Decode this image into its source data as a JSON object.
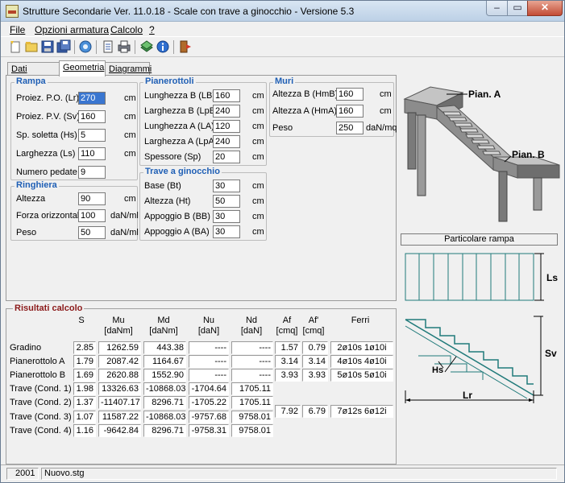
{
  "window": {
    "title": "Strutture Secondarie Ver. 11.0.18 - Scale con trave a ginocchio - Versione 5.3",
    "minimize": "–",
    "maximize": "▭",
    "close": "✕"
  },
  "menu": [
    "File",
    "Opzioni armatura",
    "Calcolo",
    "?"
  ],
  "toolbar": [
    "new-icon",
    "open-icon",
    "save-icon",
    "save-as-icon",
    "calculate-icon",
    "report-icon",
    "print-icon",
    "library-icon",
    "info-icon",
    "exit-icon"
  ],
  "tabs": [
    "Dati generali",
    "Geometria",
    "Diagrammi"
  ],
  "rampa": {
    "title": "Rampa",
    "rows": [
      {
        "label": "Proiez. P.O. (Lr)",
        "value": "270",
        "unit": "cm"
      },
      {
        "label": "Proiez. P.V. (Sv)",
        "value": "160",
        "unit": "cm"
      },
      {
        "label": "Sp. soletta (Hs)",
        "value": "5",
        "unit": "cm"
      },
      {
        "label": "Larghezza (Ls)",
        "value": "110",
        "unit": "cm"
      },
      {
        "label": "Numero pedate",
        "value": "9",
        "unit": ""
      }
    ]
  },
  "ringhiera": {
    "title": "Ringhiera",
    "rows": [
      {
        "label": "Altezza",
        "value": "90",
        "unit": "cm"
      },
      {
        "label": "Forza orizzontale",
        "value": "100",
        "unit": "daN/ml"
      },
      {
        "label": "Peso",
        "value": "50",
        "unit": "daN/ml"
      }
    ]
  },
  "pianerottoli": {
    "title": "Pianerottoli",
    "rows": [
      {
        "label": "Lunghezza B (LB)",
        "value": "160",
        "unit": "cm"
      },
      {
        "label": "Larghezza B (LpB)",
        "value": "240",
        "unit": "cm"
      },
      {
        "label": "Lunghezza A (LA)",
        "value": "120",
        "unit": "cm"
      },
      {
        "label": "Larghezza A (LpA)",
        "value": "240",
        "unit": "cm"
      },
      {
        "label": "Spessore (Sp)",
        "value": "20",
        "unit": "cm"
      }
    ]
  },
  "trave": {
    "title": "Trave a ginocchio",
    "rows": [
      {
        "label": "Base (Bt)",
        "value": "30",
        "unit": "cm"
      },
      {
        "label": "Altezza (Ht)",
        "value": "50",
        "unit": "cm"
      },
      {
        "label": "Appoggio B (BB)",
        "value": "30",
        "unit": "cm"
      },
      {
        "label": "Appoggio A (BA)",
        "value": "30",
        "unit": "cm"
      }
    ]
  },
  "muri": {
    "title": "Muri",
    "rows": [
      {
        "label": "Altezza B (HmB)",
        "value": "160",
        "unit": "cm"
      },
      {
        "label": "Altezza A (HmA)",
        "value": "160",
        "unit": "cm"
      },
      {
        "label": "Peso",
        "value": "250",
        "unit": "daN/mq"
      }
    ]
  },
  "figure": {
    "pian_a": "Pian. A",
    "pian_b": "Pian. B",
    "caption": "Particolare rampa",
    "ls": "Ls",
    "sv": "Sv",
    "hs": "Hs",
    "lr": "Lr"
  },
  "results": {
    "title": "Risultati calcolo",
    "headers": [
      {
        "top": "S",
        "bottom": ""
      },
      {
        "top": "Mu",
        "bottom": "[daNm]"
      },
      {
        "top": "Md",
        "bottom": "[daNm]"
      },
      {
        "top": "Nu",
        "bottom": "[daN]"
      },
      {
        "top": "Nd",
        "bottom": "[daN]"
      },
      {
        "top": "Af",
        "bottom": "[cmq]"
      },
      {
        "top": "Af'",
        "bottom": "[cmq]"
      },
      {
        "top": "Ferri",
        "bottom": ""
      }
    ],
    "rows": [
      {
        "label": "Gradino",
        "cells": [
          "2.85",
          "1262.59",
          "443.38",
          "----",
          "----",
          "1.57",
          "0.79",
          "2ø10s 1ø10i"
        ]
      },
      {
        "label": "Pianerottolo A",
        "cells": [
          "1.79",
          "2087.42",
          "1164.67",
          "----",
          "----",
          "3.14",
          "3.14",
          "4ø10s 4ø10i"
        ]
      },
      {
        "label": "Pianerottolo B",
        "cells": [
          "1.69",
          "2620.88",
          "1552.90",
          "----",
          "----",
          "3.93",
          "3.93",
          "5ø10s 5ø10i"
        ]
      },
      {
        "label": "Trave (Cond. 1)",
        "cells": [
          "1.98",
          "13326.63",
          "-10868.03",
          "-1704.64",
          "1705.11"
        ]
      },
      {
        "label": "Trave (Cond. 2)",
        "cells": [
          "1.37",
          "-11407.17",
          "8296.71",
          "-1705.22",
          "1705.11"
        ]
      },
      {
        "label": "Trave (Cond. 3)",
        "cells": [
          "1.07",
          "11587.22",
          "-10868.03",
          "-9757.68",
          "9758.01"
        ]
      },
      {
        "label": "Trave (Cond. 4)",
        "cells": [
          "1.16",
          "-9642.84",
          "8296.71",
          "-9758.31",
          "9758.01"
        ]
      }
    ],
    "trave_reinf": [
      "7.92",
      "6.79",
      "7ø12s 6ø12i"
    ]
  },
  "status": [
    "2001",
    "Nuovo.stg"
  ]
}
